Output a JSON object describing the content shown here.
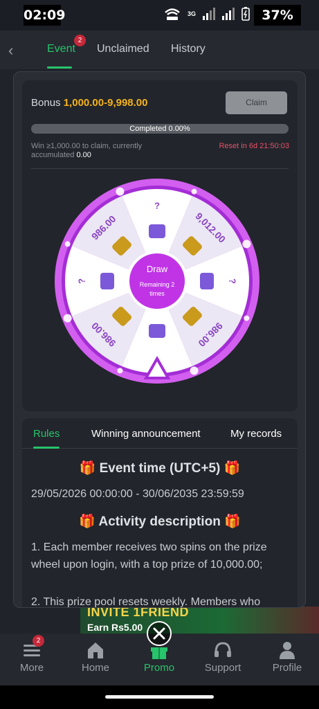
{
  "status": {
    "time": "02:09",
    "network": "3G",
    "battery": "37%"
  },
  "header": {
    "tabs": [
      {
        "label": "Event",
        "badge": "2",
        "active": true
      },
      {
        "label": "Unclaimed",
        "active": false
      },
      {
        "label": "History",
        "active": false
      }
    ]
  },
  "bonus": {
    "label": "Bonus",
    "range": "1,000.00-9,998.00",
    "claim_label": "Claim",
    "progress_text": "Completed 0.00%",
    "progress_fraction": 0.0,
    "note_prefix": "Win ≥1,000.00 to claim, currently accumulated",
    "note_value": "0.00",
    "reset": "Reset in 6d 21:50:03"
  },
  "wheel": {
    "center_title": "Draw",
    "remaining_label": "Remaining",
    "remaining_count": "2",
    "remaining_unit": "times",
    "segments": [
      "?",
      "9,012.00",
      "?",
      "986.00",
      "",
      "986.00",
      "?",
      "986.00"
    ],
    "colors": {
      "rim": "#a42dd6",
      "rim_light": "#d35ff0",
      "segment_a": "#ffffff",
      "segment_b": "#ece7f4",
      "label": "#8a45c2",
      "hub": "#c034e6"
    }
  },
  "panel": {
    "tabs": [
      {
        "label": "Rules",
        "active": true
      },
      {
        "label": "Winning announcement",
        "active": false
      },
      {
        "label": "My records",
        "active": false
      }
    ],
    "event_time_heading": "🎁 Event time (UTC+5) 🎁",
    "event_time_range": "29/05/2026 00:00:00 - 30/06/2035 23:59:59",
    "activity_heading": "🎁 Activity description 🎁",
    "paragraph1": "1. Each member receives two spins on the prize wheel upon login, with a top prize of 10,000.00;",
    "paragraph2": "2. This prize pool resets weekly. Members who"
  },
  "banner": {
    "line1": "INVITE 1FRIEND",
    "line2": "Earn Rs5.00"
  },
  "bottom_nav": {
    "items": [
      {
        "label": "More",
        "icon": "menu-icon",
        "badge": "2"
      },
      {
        "label": "Home",
        "icon": "home-icon"
      },
      {
        "label": "Promo",
        "icon": "gift-icon",
        "active": true
      },
      {
        "label": "Support",
        "icon": "headset-icon"
      },
      {
        "label": "Profile",
        "icon": "person-icon"
      }
    ]
  },
  "colors": {
    "accent": "#27c46b",
    "bonus": "#f6b21b",
    "reset": "#e8516a",
    "badge": "#c5293a"
  }
}
